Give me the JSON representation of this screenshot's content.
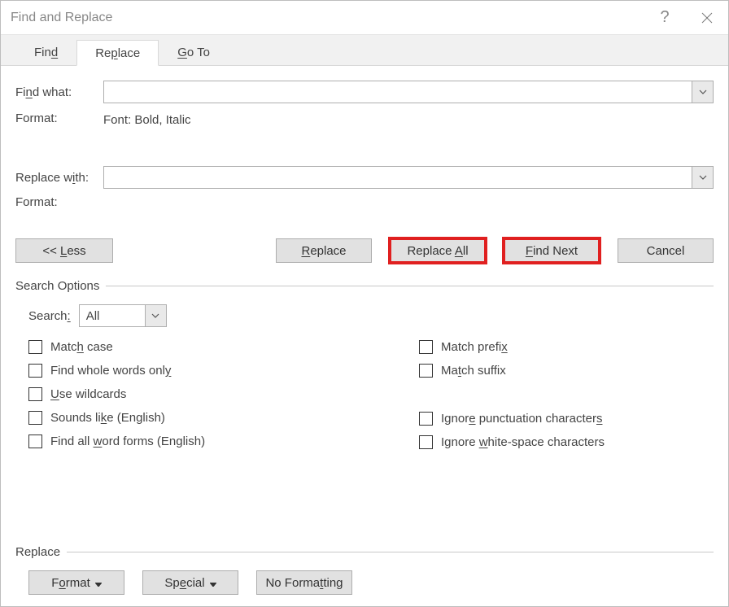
{
  "title": "Find and Replace",
  "tabs": {
    "find": "Find",
    "replace": "Replace",
    "goto": "Go To"
  },
  "fields": {
    "find_label": "Find what:",
    "find_value": "",
    "find_format_label": "Format:",
    "find_format_value": "Font: Bold, Italic",
    "replace_label": "Replace with:",
    "replace_value": "",
    "replace_format_label": "Format:",
    "replace_format_value": ""
  },
  "buttons": {
    "less": "<< Less",
    "replace": "Replace",
    "replace_all": "Replace All",
    "find_next": "Find Next",
    "cancel": "Cancel"
  },
  "search_options": {
    "heading": "Search Options",
    "search_label": "Search:",
    "search_value": "All",
    "left": {
      "match_case": "Match case",
      "whole_words": "Find whole words only",
      "wildcards": "Use wildcards",
      "sounds_like": "Sounds like (English)",
      "word_forms": "Find all word forms (English)"
    },
    "right": {
      "prefix": "Match prefix",
      "suffix": "Match suffix",
      "ignore_punct": "Ignore punctuation characters",
      "ignore_ws": "Ignore white-space characters"
    }
  },
  "replace_group": {
    "heading": "Replace",
    "format": "Format",
    "special": "Special",
    "no_formatting": "No Formatting"
  }
}
